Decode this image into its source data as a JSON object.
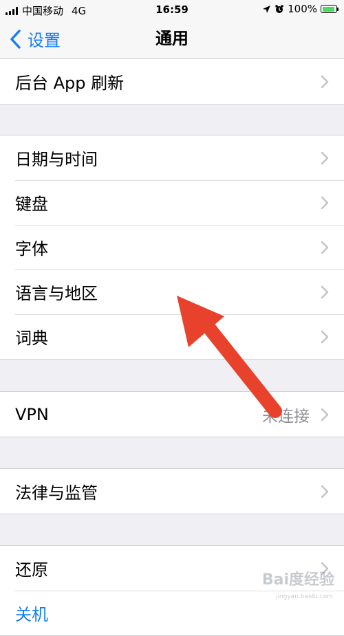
{
  "status_bar": {
    "carrier": "中国移动",
    "network": "4G",
    "time": "16:59",
    "battery_percent": "100%"
  },
  "nav": {
    "back_label": "设置",
    "title": "通用"
  },
  "groups": [
    {
      "rows": [
        {
          "label": "后台 App 刷新"
        }
      ]
    },
    {
      "rows": [
        {
          "label": "日期与时间"
        },
        {
          "label": "键盘"
        },
        {
          "label": "字体"
        },
        {
          "label": "语言与地区"
        },
        {
          "label": "词典"
        }
      ]
    },
    {
      "rows": [
        {
          "label": "VPN",
          "detail": "未连接"
        }
      ]
    },
    {
      "rows": [
        {
          "label": "法律与监管"
        }
      ]
    },
    {
      "rows": [
        {
          "label": "还原"
        },
        {
          "label": "关机"
        }
      ]
    }
  ],
  "watermark": {
    "text": "Bai度经验",
    "sub": "jingyan.baidu.com"
  },
  "colors": {
    "accent": "#147efb",
    "arrow": "#e8412c",
    "background": "#efeff4"
  }
}
